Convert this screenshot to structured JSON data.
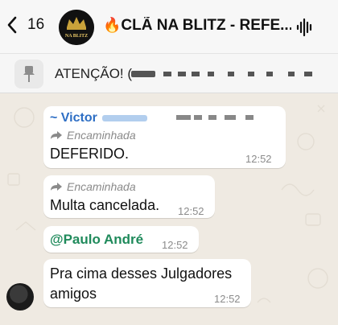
{
  "header": {
    "back_count": "16",
    "group_title": "CLÃ NA BLITZ  - REFE...",
    "fire_emoji": "🔥",
    "group_logo_text": "NA BLITZ",
    "icons": {
      "back": "chevron-left-icon",
      "audio": "audio-wave-icon"
    }
  },
  "pinned": {
    "text": "ATENÇÃO! ( ",
    "icon": "pin-icon"
  },
  "messages": [
    {
      "sender": "~ Victor",
      "forwarded_label": "Encaminhada",
      "text": "DEFERIDO.",
      "time": "12:52"
    },
    {
      "forwarded_label": "Encaminhada",
      "text": "Multa cancelada.",
      "time": "12:52"
    },
    {
      "mention": "@Paulo André",
      "time": "12:52"
    },
    {
      "text_line1": "Pra cima desses Julgadores",
      "text_line2": "amigos",
      "time": "12:52"
    }
  ],
  "colors": {
    "sender": "#2d6ec4",
    "mention": "#1f8a5b",
    "background": "#efeae2"
  }
}
